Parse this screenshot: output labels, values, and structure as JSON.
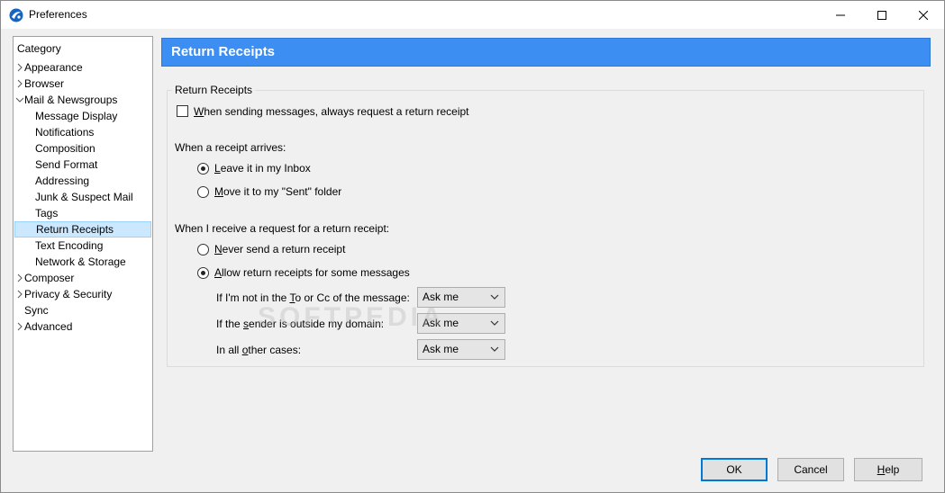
{
  "window": {
    "title": "Preferences"
  },
  "sidebar": {
    "header": "Category",
    "items": [
      {
        "label": "Appearance",
        "level": 0,
        "arrow": "right"
      },
      {
        "label": "Browser",
        "level": 0,
        "arrow": "right"
      },
      {
        "label": "Mail & Newsgroups",
        "level": 0,
        "arrow": "down"
      },
      {
        "label": "Message Display",
        "level": 1
      },
      {
        "label": "Notifications",
        "level": 1
      },
      {
        "label": "Composition",
        "level": 1
      },
      {
        "label": "Send Format",
        "level": 1
      },
      {
        "label": "Addressing",
        "level": 1
      },
      {
        "label": "Junk & Suspect Mail",
        "level": 1
      },
      {
        "label": "Tags",
        "level": 1
      },
      {
        "label": "Return Receipts",
        "level": 1,
        "selected": true
      },
      {
        "label": "Text Encoding",
        "level": 1
      },
      {
        "label": "Network & Storage",
        "level": 1
      },
      {
        "label": "Composer",
        "level": 0,
        "arrow": "right"
      },
      {
        "label": "Privacy & Security",
        "level": 0,
        "arrow": "right"
      },
      {
        "label": "Sync",
        "level": 0
      },
      {
        "label": "Advanced",
        "level": 0,
        "arrow": "right"
      }
    ]
  },
  "content": {
    "header": "Return Receipts",
    "group_title": "Return Receipts",
    "always_request": {
      "pre": "",
      "u": "W",
      "post": "hen sending messages, always request a return receipt",
      "checked": false
    },
    "arrives_label": "When a receipt arrives:",
    "leave_inbox": {
      "pre": "",
      "u": "L",
      "post": "eave it in my Inbox",
      "checked": true
    },
    "move_sent": {
      "pre": "",
      "u": "M",
      "post": "ove it to my \"Sent\" folder",
      "checked": false
    },
    "request_label": "When I receive a request for a return receipt:",
    "never_send": {
      "pre": "",
      "u": "N",
      "post": "ever send a return receipt",
      "checked": false
    },
    "allow_some": {
      "pre": "",
      "u": "A",
      "post": "llow return receipts for some messages",
      "checked": true
    },
    "not_in_to": {
      "pre": "If I'm not in the ",
      "u": "T",
      "post": "o or Cc of the message:",
      "value": "Ask me"
    },
    "outside_domain": {
      "pre": "If the ",
      "u": "s",
      "post": "ender is outside my domain:",
      "value": "Ask me"
    },
    "other_cases": {
      "pre": "In all ",
      "u": "o",
      "post": "ther cases:",
      "value": "Ask me"
    }
  },
  "footer": {
    "ok": "OK",
    "cancel": "Cancel",
    "help": {
      "u": "H",
      "post": "elp"
    }
  },
  "watermark": "SOFTPEDIA",
  "colors": {
    "header_bg": "#3c8ef3",
    "selected_bg": "#cce8ff",
    "default_button_border": "#0078d7"
  }
}
